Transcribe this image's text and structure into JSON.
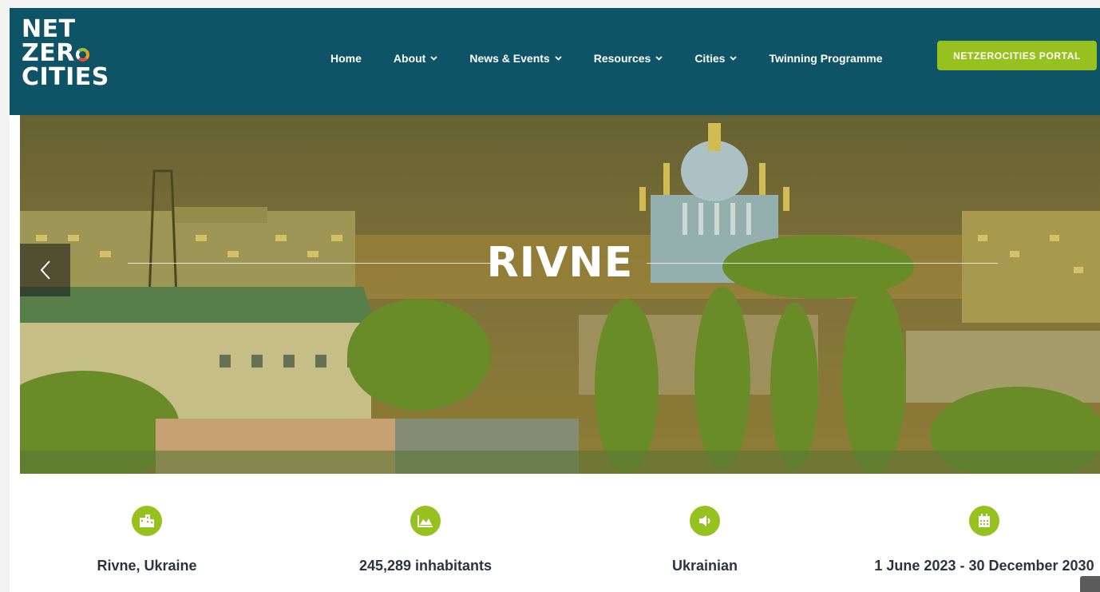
{
  "logo": {
    "line1": "NET",
    "line2": "ZER",
    "line3": "CITIES"
  },
  "nav": {
    "home": "Home",
    "about": "About",
    "news": "News & Events",
    "resources": "Resources",
    "cities": "Cities",
    "twinning": "Twinning Programme"
  },
  "portal_button": "NETZEROCITIES PORTAL",
  "hero": {
    "title": "RIVNE"
  },
  "info": [
    {
      "icon": "city-buildings-icon",
      "text": "Rivne, Ukraine"
    },
    {
      "icon": "area-chart-icon",
      "text": "245,289 inhabitants"
    },
    {
      "icon": "speaker-volume-icon",
      "text": "Ukrainian"
    },
    {
      "icon": "calendar-icon",
      "text": "1 June 2023 - 30 December 2030"
    }
  ],
  "colors": {
    "header": "#0f5466",
    "accent": "#96c11f",
    "text": "#2c3340"
  }
}
